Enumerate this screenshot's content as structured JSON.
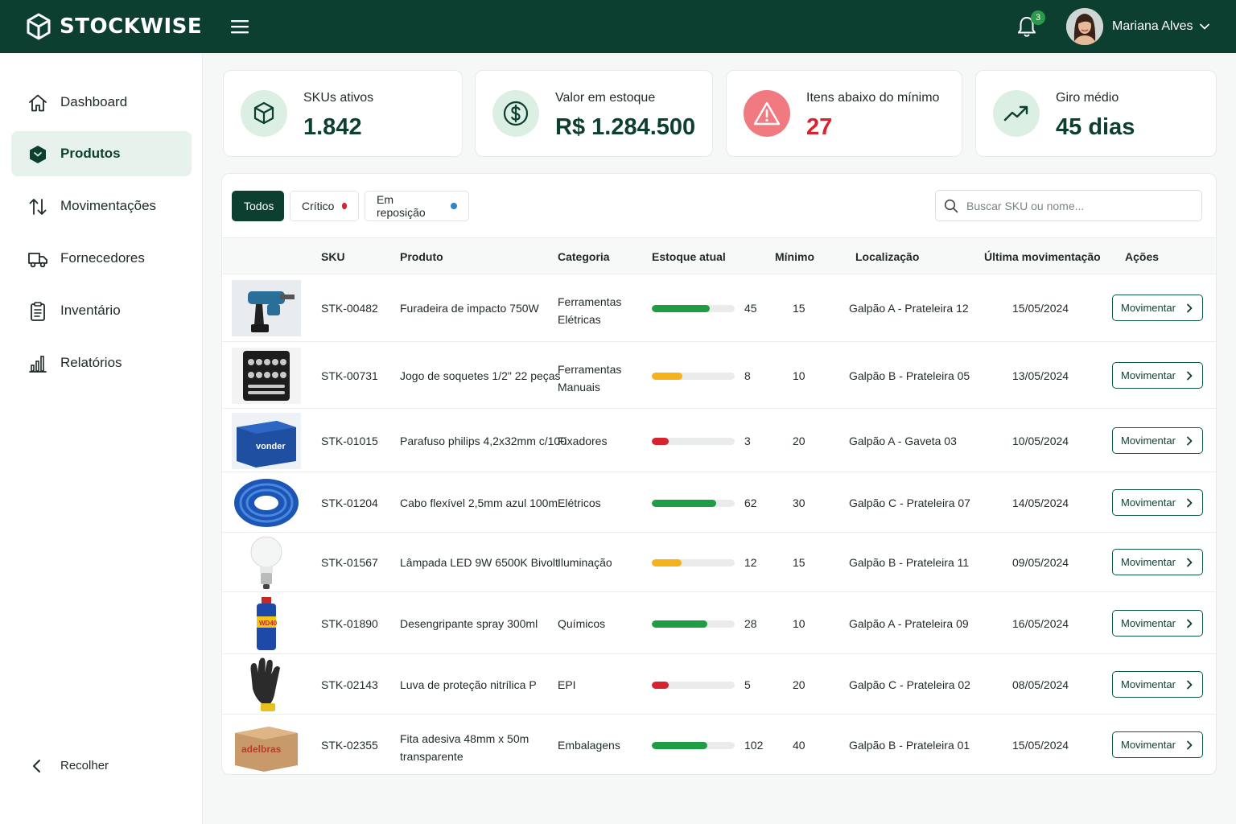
{
  "brand": {
    "name": "STOCKWISE"
  },
  "header": {
    "notifications_count": "3",
    "user_name": "Mariana Alves"
  },
  "sidebar": {
    "items": [
      {
        "label": "Dashboard",
        "icon": "home-icon",
        "active": false
      },
      {
        "label": "Produtos",
        "icon": "box-icon",
        "active": true
      },
      {
        "label": "Movimentações",
        "icon": "arrows-up-down-icon",
        "active": false
      },
      {
        "label": "Fornecedores",
        "icon": "truck-icon",
        "active": false
      },
      {
        "label": "Inventário",
        "icon": "clipboard-icon",
        "active": false
      },
      {
        "label": "Relatórios",
        "icon": "bar-chart-icon",
        "active": false
      }
    ],
    "collapse_label": "Recolher"
  },
  "kpis": [
    {
      "label": "SKUs ativos",
      "value": "1.842",
      "icon": "cube-icon",
      "tone": "green"
    },
    {
      "label": "Valor em estoque",
      "value": "R$ 1.284.500",
      "icon": "dollar-circle-icon",
      "tone": "green"
    },
    {
      "label": "Itens abaixo do mínimo",
      "value": "27",
      "icon": "warning-icon",
      "tone": "red"
    },
    {
      "label": "Giro médio",
      "value": "45 dias",
      "icon": "trending-up-icon",
      "tone": "green"
    }
  ],
  "filters": {
    "chips": [
      {
        "label": "Todos",
        "active": true,
        "dot_color": ""
      },
      {
        "label": "Crítico",
        "active": false,
        "dot_color": "#d5232f"
      },
      {
        "label": "Em reposição",
        "active": false,
        "dot_color": "#2f86c9"
      }
    ],
    "search_placeholder": "Buscar SKU ou nome..."
  },
  "table": {
    "columns": [
      "SKU",
      "Produto",
      "Categoria",
      "Estoque atual",
      "Mínimo",
      "Localização",
      "Última movimentação",
      "Ações"
    ],
    "rows": [
      {
        "sku": "STK-00482",
        "product": "Furadeira de impacto 750W",
        "category": "Ferramentas Elétricas",
        "stock": 45,
        "min": 15,
        "location": "Galpão A - Prateleira 12",
        "last_move": "15/05/2024",
        "action": "Movimentar",
        "level": 0.7,
        "status_color": "#1f9d45",
        "image": "drill"
      },
      {
        "sku": "STK-00731",
        "product": "Jogo de soquetes 1/2\" 22 peças",
        "category": "Ferramentas Manuais",
        "stock": 8,
        "min": 10,
        "location": "Galpão B - Prateleira 05",
        "last_move": "13/05/2024",
        "action": "Movimentar",
        "level": 0.37,
        "status_color": "#f5b21b",
        "image": "socket-set"
      },
      {
        "sku": "STK-01015",
        "product": "Parafuso philips 4,2x32mm c/100",
        "category": "Fixadores",
        "stock": 3,
        "min": 20,
        "location": "Galpão A - Gaveta 03",
        "last_move": "10/05/2024",
        "action": "Movimentar",
        "level": 0.2,
        "status_color": "#d5232f",
        "image": "screw-box"
      },
      {
        "sku": "STK-01204",
        "product": "Cabo flexível 2,5mm azul 100m",
        "category": "Elétricos",
        "stock": 62,
        "min": 30,
        "location": "Galpão C - Prateleira 07",
        "last_move": "14/05/2024",
        "action": "Movimentar",
        "level": 0.78,
        "status_color": "#1f9d45",
        "image": "cable"
      },
      {
        "sku": "STK-01567",
        "product": "Lâmpada LED 9W 6500K Bivolt",
        "category": "Iluminação",
        "stock": 12,
        "min": 15,
        "location": "Galpão B - Prateleira 11",
        "last_move": "09/05/2024",
        "action": "Movimentar",
        "level": 0.36,
        "status_color": "#f5b21b",
        "image": "bulb"
      },
      {
        "sku": "STK-01890",
        "product": "Desengripante spray 300ml",
        "category": "Químicos",
        "stock": 28,
        "min": 10,
        "location": "Galpão A - Prateleira 09",
        "last_move": "16/05/2024",
        "action": "Movimentar",
        "level": 0.67,
        "status_color": "#1f9d45",
        "image": "spray"
      },
      {
        "sku": "STK-02143",
        "product": "Luva de proteção nitrílica P",
        "category": "EPI",
        "stock": 5,
        "min": 20,
        "location": "Galpão C - Prateleira 02",
        "last_move": "08/05/2024",
        "action": "Movimentar",
        "level": 0.2,
        "status_color": "#d5232f",
        "image": "glove"
      },
      {
        "sku": "STK-02355",
        "product": "Fita adesiva 48mm x 50m transparente",
        "category": "Embalagens",
        "stock": 102,
        "min": 40,
        "location": "Galpão B - Prateleira 01",
        "last_move": "15/05/2024",
        "action": "Movimentar",
        "level": 0.67,
        "status_color": "#1f9d45",
        "image": "tape-box"
      }
    ]
  }
}
